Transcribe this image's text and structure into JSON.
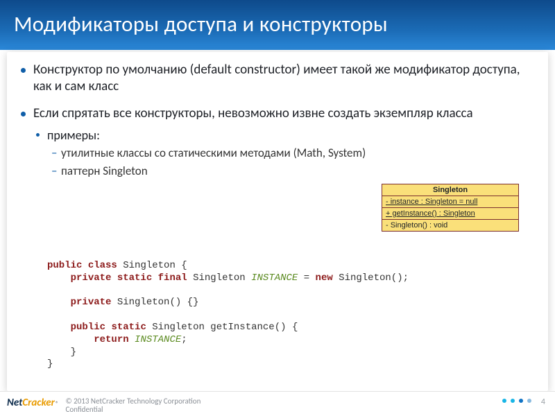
{
  "header": {
    "title": "Модификаторы доступа и конструкторы"
  },
  "bullets": {
    "b1": "Конструктор по умолчанию (default constructor) имеет такой же модификатор доступа, как и сам класс",
    "b2": "Если спрятать все конструкторы, невозможно извне создать экземпляр класса",
    "b2_1": "примеры:",
    "b2_1_1": "утилитные классы со статическими методами (Math, System)",
    "b2_1_2": "паттерн Singleton"
  },
  "uml": {
    "title": "Singleton",
    "row1": "- instance : Singleton = null",
    "row2": "+ getInstance() : Singleton",
    "row3": "- Singleton() : void"
  },
  "code": {
    "kw_public": "public",
    "kw_class": "class",
    "kw_private": "private",
    "kw_static": "static",
    "kw_final": "final",
    "kw_new": "new",
    "kw_return": "return",
    "id_singleton": "Singleton",
    "id_instance": "INSTANCE",
    "id_getinstance": "getInstance",
    "sym_obrace": "{",
    "sym_cbrace": "}",
    "sym_eq": "=",
    "sym_parens": "()",
    "sym_empty": "{}",
    "sym_semi": ";",
    "sym_call": "();"
  },
  "footer": {
    "logo_net": "Net",
    "logo_cracker": "Cracker",
    "logo_r": "®",
    "copyright_l1": "© 2013 NetCracker Technology Corporation",
    "copyright_l2": "Confidential",
    "page": "4"
  }
}
